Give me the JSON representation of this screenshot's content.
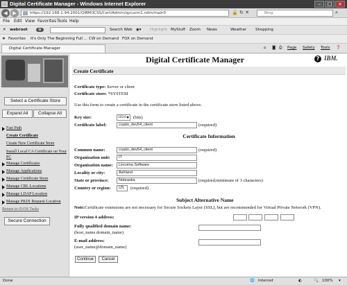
{
  "window": {
    "title": "Digital Certificate Manager - Windows Internet Explorer",
    "url": "https://192.168.1.94:2001/QIBM/ICSS/Cert/Admin/qycucm1.ndm/main0",
    "search_placeholder": "Bing",
    "min": "–",
    "max": "□",
    "close": "×"
  },
  "menu": [
    "File",
    "Edit",
    "View",
    "Favorites",
    "Tools",
    "Help"
  ],
  "toolbar": {
    "webroot": "webroot",
    "search_web": "Search Web",
    "highlight": "Highlight",
    "myStuff": "MyStuff",
    "zoom": "Zoom",
    "news": "News",
    "weather": "Weather",
    "shopping": "Shopping"
  },
  "favorites": {
    "label": "Favorites",
    "items": [
      "It's Only The Beginning Full ...",
      "CW on Demand",
      "FOX on Demand"
    ]
  },
  "tab": {
    "label": "Digital Certificate Manager",
    "page_menu": "Page",
    "safety_menu": "Safety",
    "tools_menu": "Tools"
  },
  "sidebar": {
    "select_store_label": "Select a Certificate Store",
    "expand_all": "Expand All",
    "collapse_all": "Collapse All",
    "nav": [
      {
        "label": "Fast Path",
        "arrow": true
      },
      {
        "label": "Create Certificate",
        "arrow": false,
        "active": true
      },
      {
        "label": "Create New Certificate Store",
        "arrow": false
      },
      {
        "label": "Install Local CA Certificate on Your PC",
        "arrow": false,
        "tall": true
      },
      {
        "label": "Manage Certificates",
        "arrow": true
      },
      {
        "label": "Manage Applications",
        "arrow": true
      },
      {
        "label": "Manage Certificate Store",
        "arrow": true
      },
      {
        "label": "Manage CRL Locations",
        "arrow": true
      },
      {
        "label": "Manage LDAP Location",
        "arrow": true
      },
      {
        "label": "Manage PKIX Request Location",
        "arrow": true
      },
      {
        "label": "Return to i5/OS Tasks",
        "arrow": false,
        "ret": true
      }
    ],
    "secure_connection": "Secure Connection"
  },
  "header": {
    "title": "Digital Certificate Manager",
    "help_icon": "?",
    "brand": "IBM."
  },
  "form": {
    "section_title": "Create Certificate",
    "cert_type_label": "Certificate type:",
    "cert_type_value": "Server or client",
    "cert_store_label": "Certificate store:",
    "cert_store_value": "*SYSTEM",
    "instructions": "Use this form to create a certificate in the certificate store listed above.",
    "key_size_label": "Key size:",
    "key_size_value": "1024",
    "key_size_unit": "(bits)",
    "cert_label_label": "Certificate label:",
    "cert_label_value": "crypto_dev54_client",
    "required": "(required)",
    "cert_info_title": "Certificate Information",
    "common_name_label": "Common name:",
    "common_name_value": "crypto_dev54_client",
    "org_unit_label": "Organization unit:",
    "org_unit_value": "IT",
    "org_name_label": "Organization name:",
    "org_name_value": "Lincoma Software",
    "locality_label": "Locality or city:",
    "locality_value": "Ashland",
    "state_label": "State or province:",
    "state_value": "Nebraska",
    "state_required": "(required;minimum of 3 characters)",
    "country_label": "Country or region:",
    "country_value": "US",
    "san_title": "Subject Alternative Name",
    "note_bold": "Note:",
    "note_text": "Certificate extensions are not necessary for Secure Sockets Layer (SSL), but are recommended for Virtual Private Network (VPN).",
    "ip_label": "IP version 4 address:",
    "fqdn_label": "Fully qualified domain name:",
    "fqdn_hint": "(host_name.domain_name)",
    "email_label": "E-mail address:",
    "email_hint": "(user_name@domain_name)",
    "continue": "Continue",
    "cancel": "Cancel"
  },
  "status": {
    "left": "Done",
    "zone": "Internet",
    "zoom": "100%"
  }
}
